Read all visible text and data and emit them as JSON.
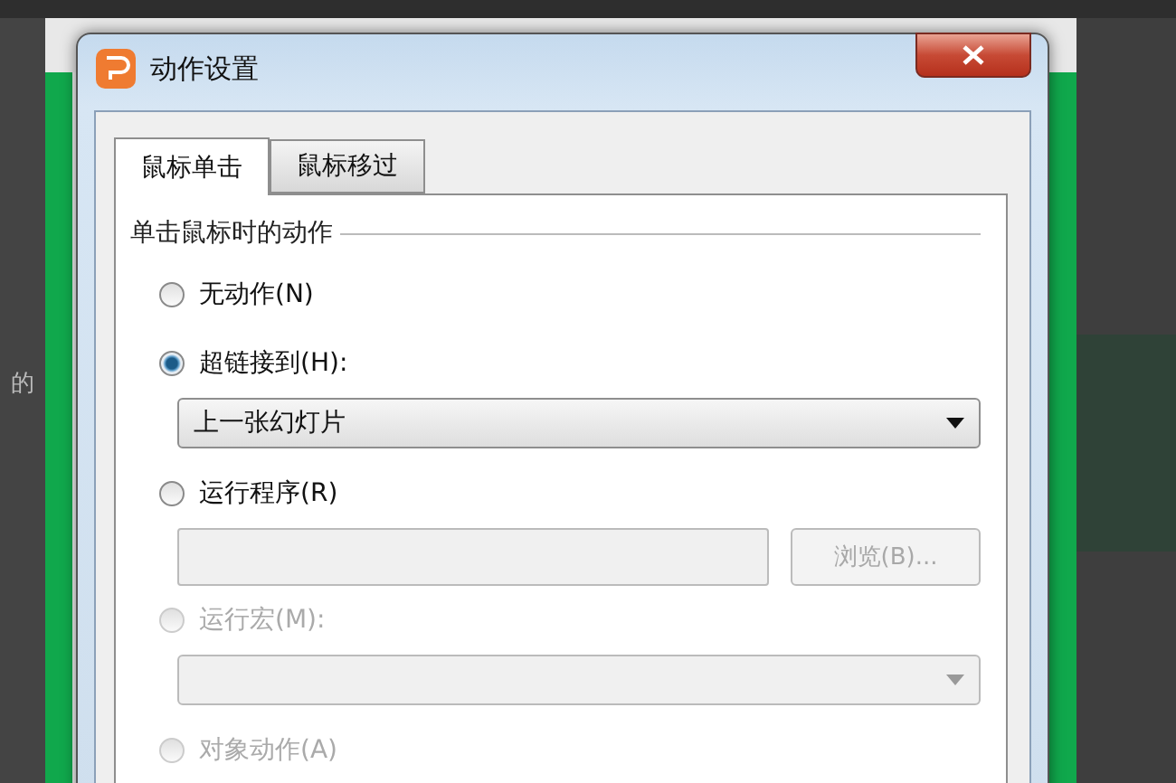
{
  "background": {
    "texts": [
      "的"
    ]
  },
  "window": {
    "title": "动作设置"
  },
  "tabs": [
    {
      "label": "鼠标单击",
      "selected": true
    },
    {
      "label": "鼠标移过",
      "selected": false
    }
  ],
  "group": {
    "title": "单击鼠标时的动作",
    "options": [
      {
        "kind": "radio",
        "label": "无动作(N)",
        "selected": false,
        "disabled": false
      },
      {
        "kind": "radio",
        "label": "超链接到(H):",
        "selected": true,
        "disabled": false
      },
      {
        "kind": "dropdown",
        "value": "上一张幻灯片",
        "disabled": false
      },
      {
        "kind": "radio",
        "label": "运行程序(R)",
        "selected": false,
        "disabled": false
      },
      {
        "kind": "path",
        "button": "浏览(B)...",
        "disabled": true
      },
      {
        "kind": "radio",
        "label": "运行宏(M):",
        "selected": false,
        "disabled": true
      },
      {
        "kind": "dropdown",
        "disabled": true
      },
      {
        "kind": "radio",
        "label": "对象动作(A)",
        "selected": false,
        "disabled": true
      }
    ]
  }
}
